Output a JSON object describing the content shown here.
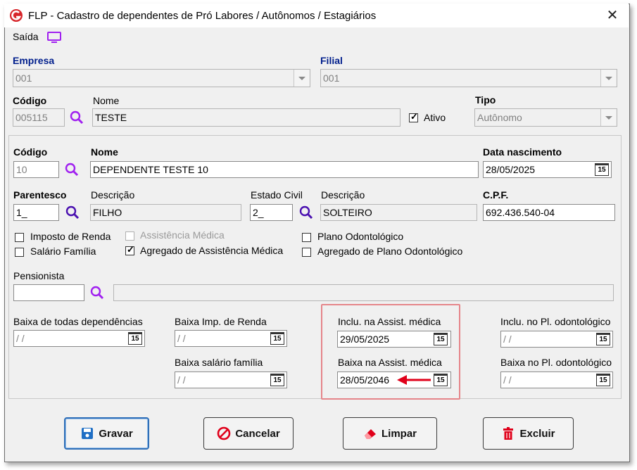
{
  "window": {
    "title": "FLP - Cadastro de dependentes de Pró Labores / Autônomos / Estagiários",
    "close": "✕"
  },
  "menu": {
    "saida": "Saída"
  },
  "empresa": {
    "label": "Empresa",
    "value": "001"
  },
  "filial": {
    "label": "Filial",
    "value": "001"
  },
  "codigo": {
    "label": "Código",
    "value": "005115"
  },
  "nome": {
    "label": "Nome",
    "value": "TESTE"
  },
  "ativo": {
    "label": "Ativo",
    "checked": true
  },
  "tipo": {
    "label": "Tipo",
    "value": "Autônomo"
  },
  "dep": {
    "codigo_label": "Código",
    "codigo_value": "10",
    "nome_label": "Nome",
    "nome_value": "DEPENDENTE TESTE 10",
    "nasc_label": "Data nascimento",
    "nasc_value": "28/05/2025",
    "parentesco_label": "Parentesco",
    "parentesco_value": "1_",
    "descricao_label": "Descrição",
    "descricao_value": "FILHO",
    "estado_civil_label": "Estado Civil",
    "estado_civil_value": "2_",
    "descricao2_label": "Descrição",
    "descricao2_value": "SOLTEIRO",
    "cpf_label": "C.P.F.",
    "cpf_value": "692.436.540-04"
  },
  "checks": {
    "imposto_renda": "Imposto de Renda",
    "assistencia_medica": "Assistência Médica",
    "plano_odonto": "Plano Odontológico",
    "salario_familia": "Salário Família",
    "agregado_assist": "Agregado de Assistência Médica",
    "agregado_odonto": "Agregado de Plano Odontológico"
  },
  "pensionista": {
    "label": "Pensionista",
    "value": "",
    "desc": ""
  },
  "datas": {
    "baixa_todas_label": "Baixa de todas dependências",
    "baixa_todas_value": " /  /",
    "baixa_imp_label": "Baixa Imp. de Renda",
    "baixa_imp_value": " /  /",
    "baixa_sal_label": "Baixa salário família",
    "baixa_sal_value": " /  /",
    "inclu_assist_label": "Inclu. na Assist. médica",
    "inclu_assist_value": "29/05/2025",
    "baixa_assist_label": "Baixa na Assist. médica",
    "baixa_assist_value": "28/05/2046",
    "inclu_odonto_label": "Inclu. no Pl. odontológico",
    "inclu_odonto_value": " /  /",
    "baixa_odonto_label": "Baixa no Pl. odontológico",
    "baixa_odonto_value": " /  /"
  },
  "cal_glyph": "15",
  "buttons": {
    "gravar": "Gravar",
    "cancelar": "Cancelar",
    "limpar": "Limpar",
    "excluir": "Excluir"
  },
  "colors": {
    "accent": "#001e8c",
    "search": "#a020f0",
    "highlight": "#e5858a",
    "arrow": "#e0001a"
  },
  "icons": [
    "app-logo-icon",
    "monitor-icon",
    "search-icon",
    "calendar-icon",
    "save-icon",
    "cancel-icon",
    "eraser-icon",
    "trash-icon"
  ]
}
